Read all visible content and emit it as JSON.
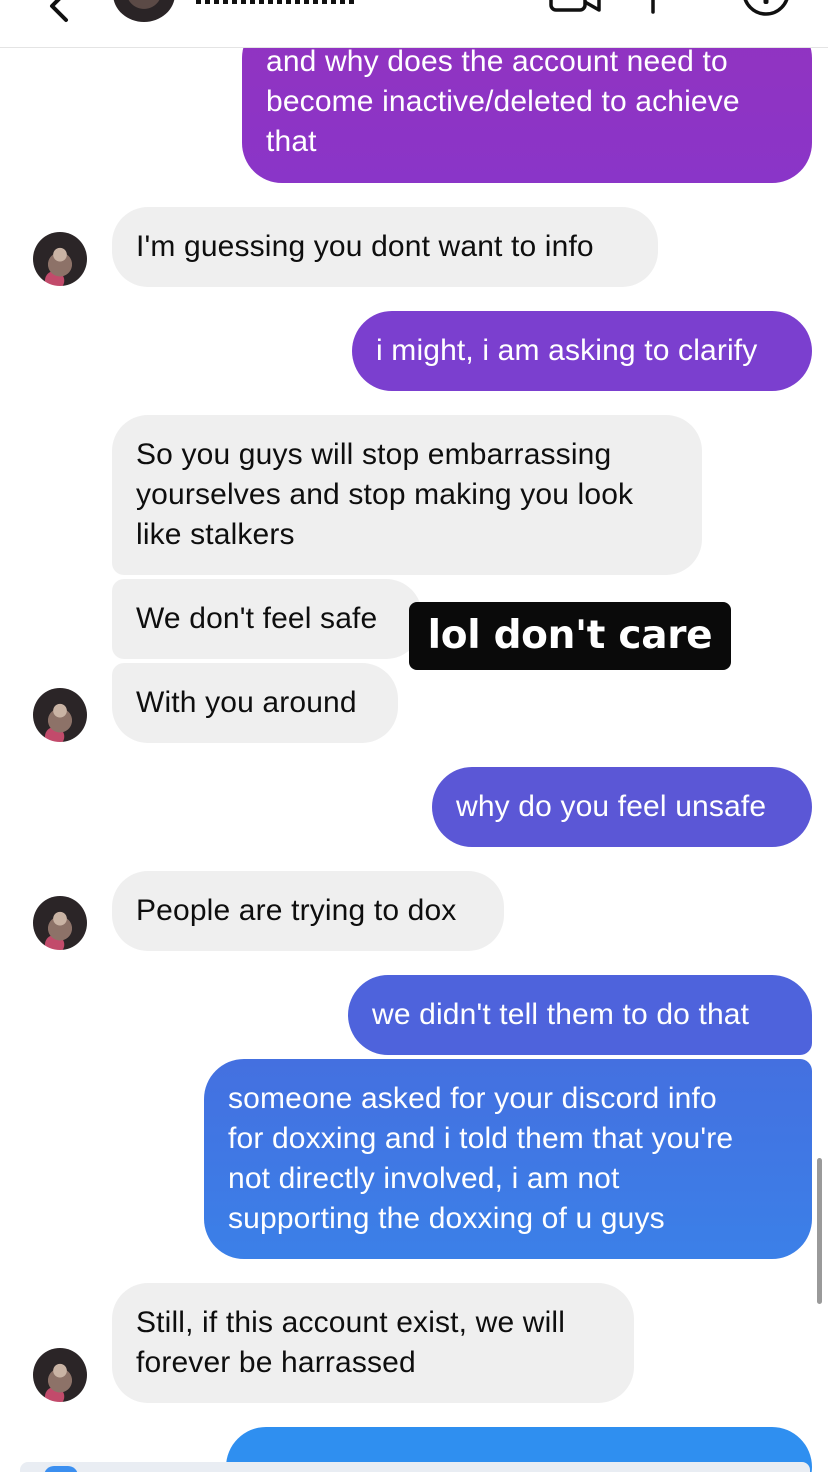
{
  "header": {
    "contact_name_masked": "▮▮▮▮▮▮▮▮▮",
    "icons": [
      "back-chevron-icon",
      "video-call-icon",
      "phone-icon",
      "info-icon"
    ]
  },
  "sticker_overlay": "lol don't care",
  "messages": [
    {
      "sender": "me",
      "text": "and why does the account need to\nbecome inactive/deleted to achieve\nthat"
    },
    {
      "sender": "them",
      "text": "I'm guessing you dont want to info"
    },
    {
      "sender": "me",
      "text": "i might, i am asking to clarify"
    },
    {
      "sender": "them",
      "text": "So you guys will stop embarrassing\nyourselves and stop making you look\nlike stalkers"
    },
    {
      "sender": "them",
      "text": "We don't feel safe"
    },
    {
      "sender": "them",
      "text": "With you around"
    },
    {
      "sender": "me",
      "text": "why do you feel unsafe"
    },
    {
      "sender": "them",
      "text": "People are trying to dox"
    },
    {
      "sender": "me",
      "text": "we didn't tell them to do that"
    },
    {
      "sender": "me",
      "text": "someone asked for your discord info\nfor doxxing and i told them that you're\nnot directly involved, i am not\nsupporting the doxxing of u guys"
    },
    {
      "sender": "them",
      "text": "Still, if this account exist, we will\nforever be harrassed"
    },
    {
      "sender": "me",
      "text": ""
    }
  ],
  "colors": {
    "received_bg": "#efefef",
    "sent_gradient": [
      "#8c32c6",
      "#7a3fd0",
      "#5a5ad6",
      "#4d63dc",
      "#3f7be4",
      "#2f8ff0"
    ]
  }
}
